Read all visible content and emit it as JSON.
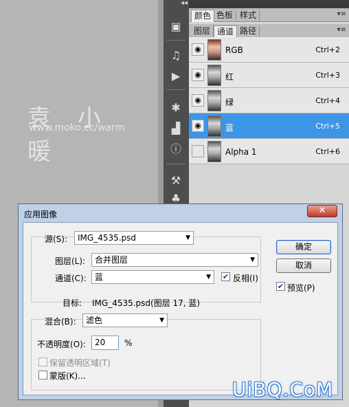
{
  "watermark": {
    "title": "袁 小 暖",
    "url": "www.moko.cc/warm"
  },
  "panel": {
    "collapse_glyph": "◂◂",
    "top_tabs": [
      "颜色",
      "色板",
      "样式"
    ],
    "sub_tabs": [
      "图层",
      "通道",
      "路径"
    ],
    "active_sub_tab": "通道",
    "channels": [
      {
        "name": "RGB",
        "shortcut": "Ctrl+2",
        "visible": true,
        "selected": false
      },
      {
        "name": "红",
        "shortcut": "Ctrl+3",
        "visible": true,
        "selected": false
      },
      {
        "name": "绿",
        "shortcut": "Ctrl+4",
        "visible": true,
        "selected": false
      },
      {
        "name": "蓝",
        "shortcut": "Ctrl+5",
        "visible": true,
        "selected": true
      },
      {
        "name": "Alpha 1",
        "shortcut": "Ctrl+6",
        "visible": false,
        "selected": false
      }
    ],
    "selected_color": "#3d95e6"
  },
  "toolstrip": {
    "icons": [
      "history-icon",
      "actions-icon",
      "play-icon",
      "brushes-icon",
      "histogram-icon",
      "info-icon",
      "tool-presets-icon",
      "clone-source-icon"
    ]
  },
  "dialog": {
    "title": "应用图像",
    "close_glyph": "✕",
    "source": {
      "label": "源(S):",
      "value": "IMG_4535.psd"
    },
    "layer": {
      "label": "图层(L):",
      "value": "合并图层"
    },
    "channel": {
      "label": "通道(C):",
      "value": "蓝"
    },
    "invert": {
      "label": "反相(I)",
      "checked": true
    },
    "target": {
      "label": "目标:",
      "value": "IMG_4535.psd(图层 17, 蓝)"
    },
    "blending": {
      "label": "混合(B):",
      "value": "滤色"
    },
    "opacity": {
      "label": "不透明度(O):",
      "value": "20",
      "unit": "%"
    },
    "preserve_transparency": {
      "label": "保留透明区域(T)",
      "checked": false,
      "disabled": true
    },
    "mask": {
      "label": "蒙版(K)...",
      "checked": false
    },
    "ok_label": "确定",
    "cancel_label": "取消",
    "preview": {
      "label": "预览(P)",
      "checked": true
    }
  },
  "brand": "UiBQ.CoM"
}
